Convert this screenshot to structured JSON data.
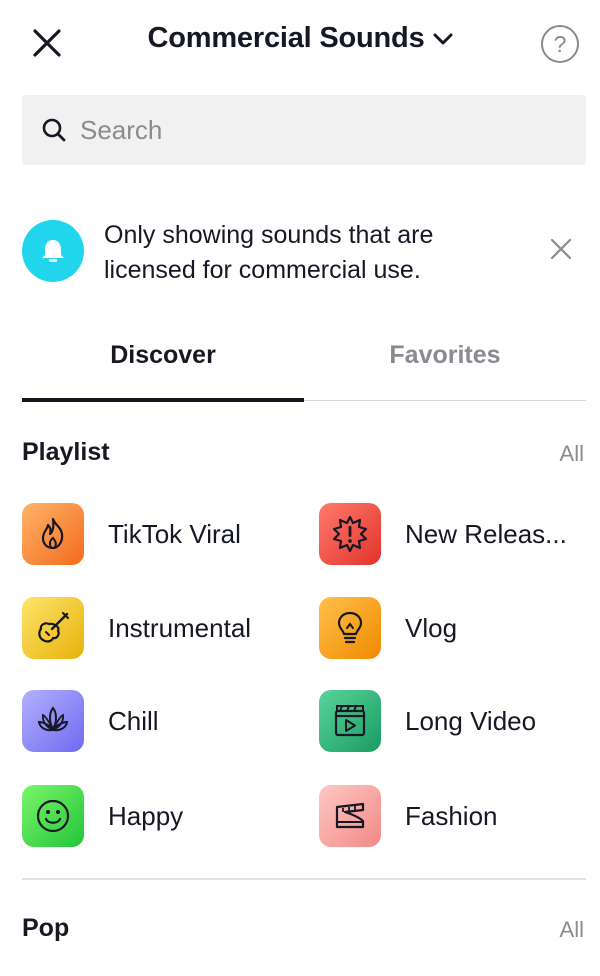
{
  "header": {
    "title": "Commercial Sounds",
    "help_symbol": "?"
  },
  "search": {
    "placeholder": "Search"
  },
  "notice": {
    "text": "Only showing sounds that are licensed for commercial use."
  },
  "tabs": [
    {
      "label": "Discover",
      "active": true
    },
    {
      "label": "Favorites",
      "active": false
    }
  ],
  "playlist": {
    "title": "Playlist",
    "all_label": "All",
    "items": [
      {
        "label": "TikTok Viral",
        "icon": "flame-icon"
      },
      {
        "label": "New Releas...",
        "icon": "burst-alert-icon"
      },
      {
        "label": "Instrumental",
        "icon": "violin-icon"
      },
      {
        "label": "Vlog",
        "icon": "lightbulb-icon"
      },
      {
        "label": "Chill",
        "icon": "lotus-icon"
      },
      {
        "label": "Long Video",
        "icon": "clapper-play-icon"
      },
      {
        "label": "Happy",
        "icon": "smiley-icon"
      },
      {
        "label": "Fashion",
        "icon": "sneaker-icon"
      }
    ]
  },
  "pop": {
    "title": "Pop",
    "all_label": "All"
  },
  "colors": {
    "accent_cyan": "#20d5ec",
    "text_primary": "#161823",
    "text_secondary": "#8a8b91",
    "search_bg": "#f1f1f2"
  }
}
